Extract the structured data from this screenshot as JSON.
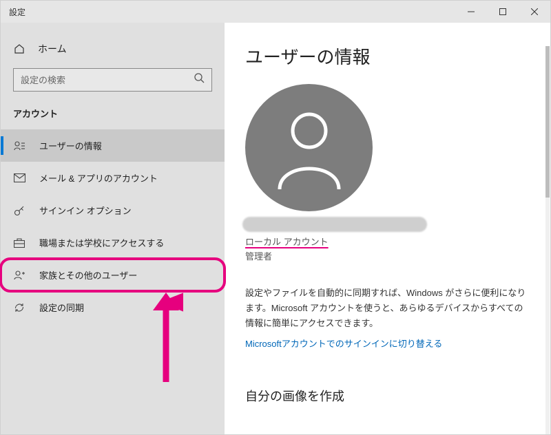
{
  "window": {
    "title": "設定"
  },
  "sidebar": {
    "home_label": "ホーム",
    "search_placeholder": "設定の検索",
    "section_label": "アカウント",
    "items": [
      {
        "label": "ユーザーの情報"
      },
      {
        "label": "メール & アプリのアカウント"
      },
      {
        "label": "サインイン オプション"
      },
      {
        "label": "職場または学校にアクセスする"
      },
      {
        "label": "家族とその他のユーザー"
      },
      {
        "label": "設定の同期"
      }
    ]
  },
  "content": {
    "page_title": "ユーザーの情報",
    "account_type": "ローカル アカウント",
    "account_role": "管理者",
    "description": "設定やファイルを自動的に同期すれば、Windows がさらに便利になります。Microsoft アカウントを使うと、あらゆるデバイスからすべての情報に簡単にアクセスできます。",
    "ms_link": "Microsoftアカウントでのサインインに切り替える",
    "section2_title": "自分の画像を作成"
  }
}
